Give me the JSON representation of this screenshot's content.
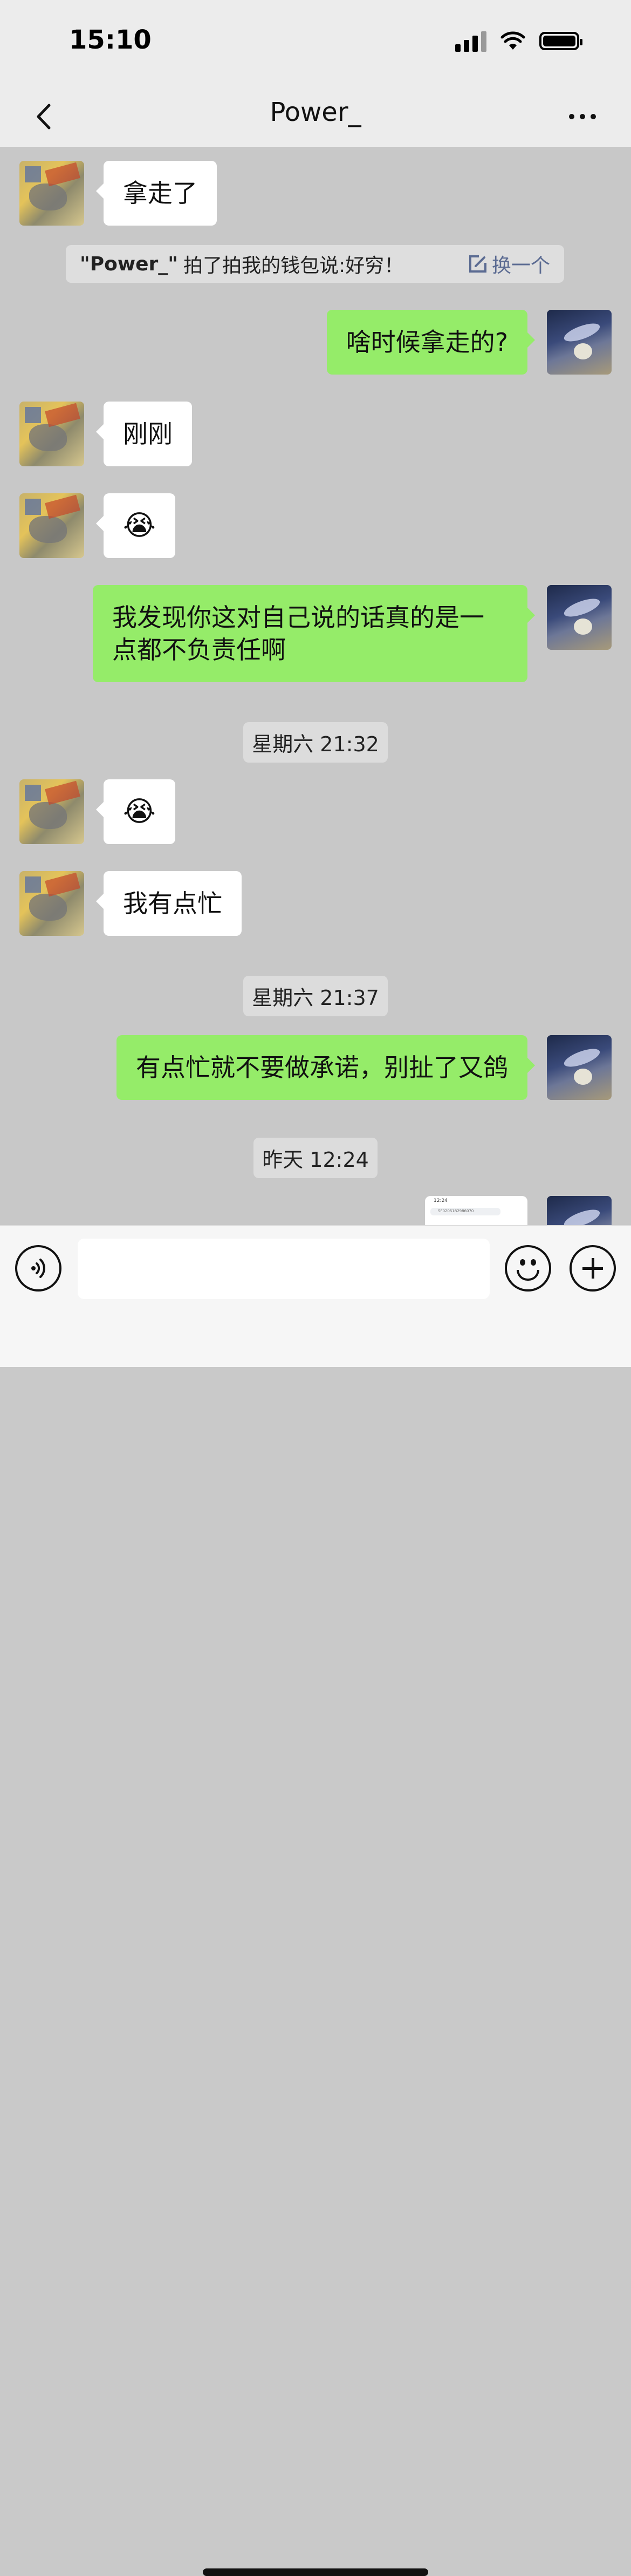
{
  "status_bar": {
    "time": "15:10"
  },
  "nav": {
    "title": "Power_"
  },
  "pat": {
    "who": "\"Power_\"",
    "text": "拍了拍我的钱包说:好穷！",
    "swap": "换一个"
  },
  "messages": [
    {
      "side": "in",
      "text": "拿走了"
    },
    {
      "side": "out",
      "text": "啥时候拿走的?"
    },
    {
      "side": "in",
      "text": "刚刚"
    },
    {
      "side": "in",
      "text": "😭"
    },
    {
      "side": "out",
      "text": "我发现你这对自己说的话真的是一点都不负责任啊"
    },
    {
      "side": "in",
      "text": "😭"
    },
    {
      "side": "in",
      "text": "我有点忙"
    },
    {
      "side": "out",
      "text": "有点忙就不要做承诺，别扯了又鸽"
    }
  ],
  "timestamps": [
    "星期六 21:32",
    "星期六 21:37",
    "昨天 12:24"
  ],
  "thumbnail": {
    "time": "12:24",
    "search": "SF0205182986070"
  },
  "input": {
    "placeholder": ""
  },
  "colors": {
    "outgoing_bubble": "#95ec69",
    "incoming_bubble": "#ffffff",
    "chat_bg": "#c8c8c8"
  }
}
